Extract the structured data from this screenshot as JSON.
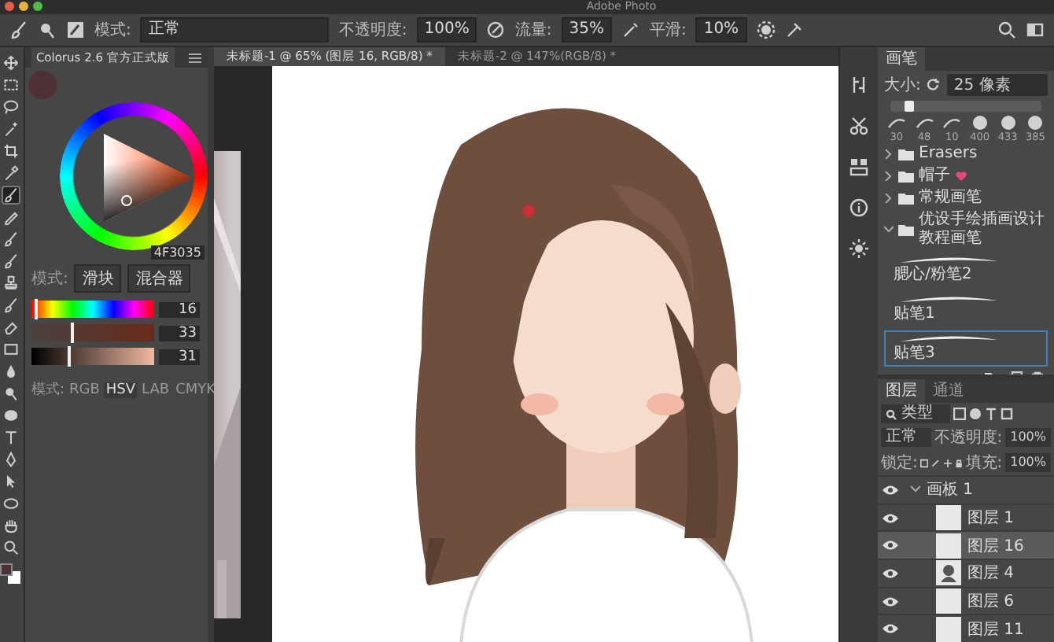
{
  "window": {
    "title": "Adobe Photo"
  },
  "options_bar": {
    "mode_label": "模式:",
    "mode": "正常",
    "opacity_label": "不透明度:",
    "opacity": "100%",
    "flow_label": "流量:",
    "flow": "35%",
    "smoothing_label": "平滑:",
    "smoothing": "10%"
  },
  "tools": [
    {
      "kind": "move",
      "selected": false
    },
    {
      "kind": "marquee",
      "selected": false
    },
    {
      "kind": "lasso",
      "selected": false
    },
    {
      "kind": "wand",
      "selected": false
    },
    {
      "kind": "crop",
      "selected": false
    },
    {
      "kind": "eyedropper",
      "selected": false
    },
    {
      "kind": "brush",
      "selected": true
    },
    {
      "kind": "pencil",
      "selected": false
    },
    {
      "kind": "brush",
      "selected": false
    },
    {
      "kind": "brush",
      "selected": false
    },
    {
      "kind": "stamp",
      "selected": false
    },
    {
      "kind": "brush",
      "selected": false
    },
    {
      "kind": "eraser",
      "selected": false
    },
    {
      "kind": "gradient",
      "selected": false
    },
    {
      "kind": "drop",
      "selected": false
    },
    {
      "kind": "dodge",
      "selected": false
    },
    {
      "kind": "blob",
      "selected": false
    },
    {
      "kind": "type",
      "selected": false
    },
    {
      "kind": "pen",
      "selected": false
    },
    {
      "kind": "arrow",
      "selected": false
    },
    {
      "kind": "ellipse",
      "selected": false
    },
    {
      "kind": "hand",
      "selected": false
    },
    {
      "kind": "zoom",
      "selected": false
    }
  ],
  "swatches": [
    {
      "kind": "foreground",
      "color": "#4f3035"
    },
    {
      "kind": "background",
      "color": "#ffffff"
    }
  ],
  "colorus": {
    "title": "Colorus 2.6 官方正式版",
    "hex": "4F3035",
    "mode_label": "模式:",
    "mode_buttons": [
      "滑块",
      "混合器"
    ],
    "sliders": [
      {
        "kind": "hue",
        "level": 0.04,
        "reading": "16"
      },
      {
        "kind": "saturation",
        "level": 0.33,
        "reading": "33"
      },
      {
        "kind": "brightness",
        "level": 0.31,
        "reading": "31"
      }
    ],
    "models_label": "模式:",
    "models": [
      {
        "label": "RGB",
        "selected": false
      },
      {
        "label": "HSV",
        "selected": true
      },
      {
        "label": "LAB",
        "selected": false
      },
      {
        "label": "CMYK",
        "selected": false
      }
    ]
  },
  "document_tabs": [
    {
      "label": "未标题-1 @ 65% (图层 16, RGB/8) *",
      "selected": true
    },
    {
      "label": "未标题-2 @ 147%(RGB/8) *",
      "selected": false
    }
  ],
  "brushes": {
    "tab": "画笔",
    "size_label": "大小:",
    "size": "25 像素",
    "size_slider": {
      "level": 0.12
    },
    "presets": [
      "30",
      "48",
      "10",
      "400",
      "433",
      "385"
    ],
    "folders": [
      {
        "name": "Erasers",
        "expanded": false,
        "kind": "plain"
      },
      {
        "name": "帽子",
        "expanded": false,
        "kind": "heart"
      },
      {
        "name": "常规画笔",
        "expanded": false,
        "kind": "plain"
      },
      {
        "name": "优设手绘插画设计教程画笔",
        "expanded": true,
        "kind": "plain",
        "children": [
          {
            "name": "腮心/粉笔2",
            "selected": false
          },
          {
            "name": "贴笔1",
            "selected": false
          },
          {
            "name": "贴笔3",
            "selected": true
          }
        ]
      }
    ]
  },
  "layers": {
    "tabs": [
      {
        "label": "图层",
        "selected": true
      },
      {
        "label": "通道",
        "selected": false
      }
    ],
    "filter": "类型",
    "blend": "正常",
    "opacity_label": "不透明度:",
    "opacity": "100%",
    "lock_label": "锁定:",
    "fill_label": "填充:",
    "fill": "100%",
    "items": [
      {
        "name": "画板 1",
        "kind": "group",
        "visible": true,
        "expanded": true,
        "children": [
          {
            "name": "图层 1",
            "kind": "layer",
            "visible": true,
            "selected": false
          },
          {
            "name": "图层 16",
            "kind": "layer",
            "visible": true,
            "selected": true
          },
          {
            "name": "图层 4",
            "kind": "figure",
            "visible": true,
            "selected": false
          },
          {
            "name": "图层 6",
            "kind": "layer",
            "visible": true,
            "selected": false
          },
          {
            "name": "图层 11",
            "kind": "layer",
            "visible": true,
            "selected": false
          }
        ]
      }
    ]
  }
}
